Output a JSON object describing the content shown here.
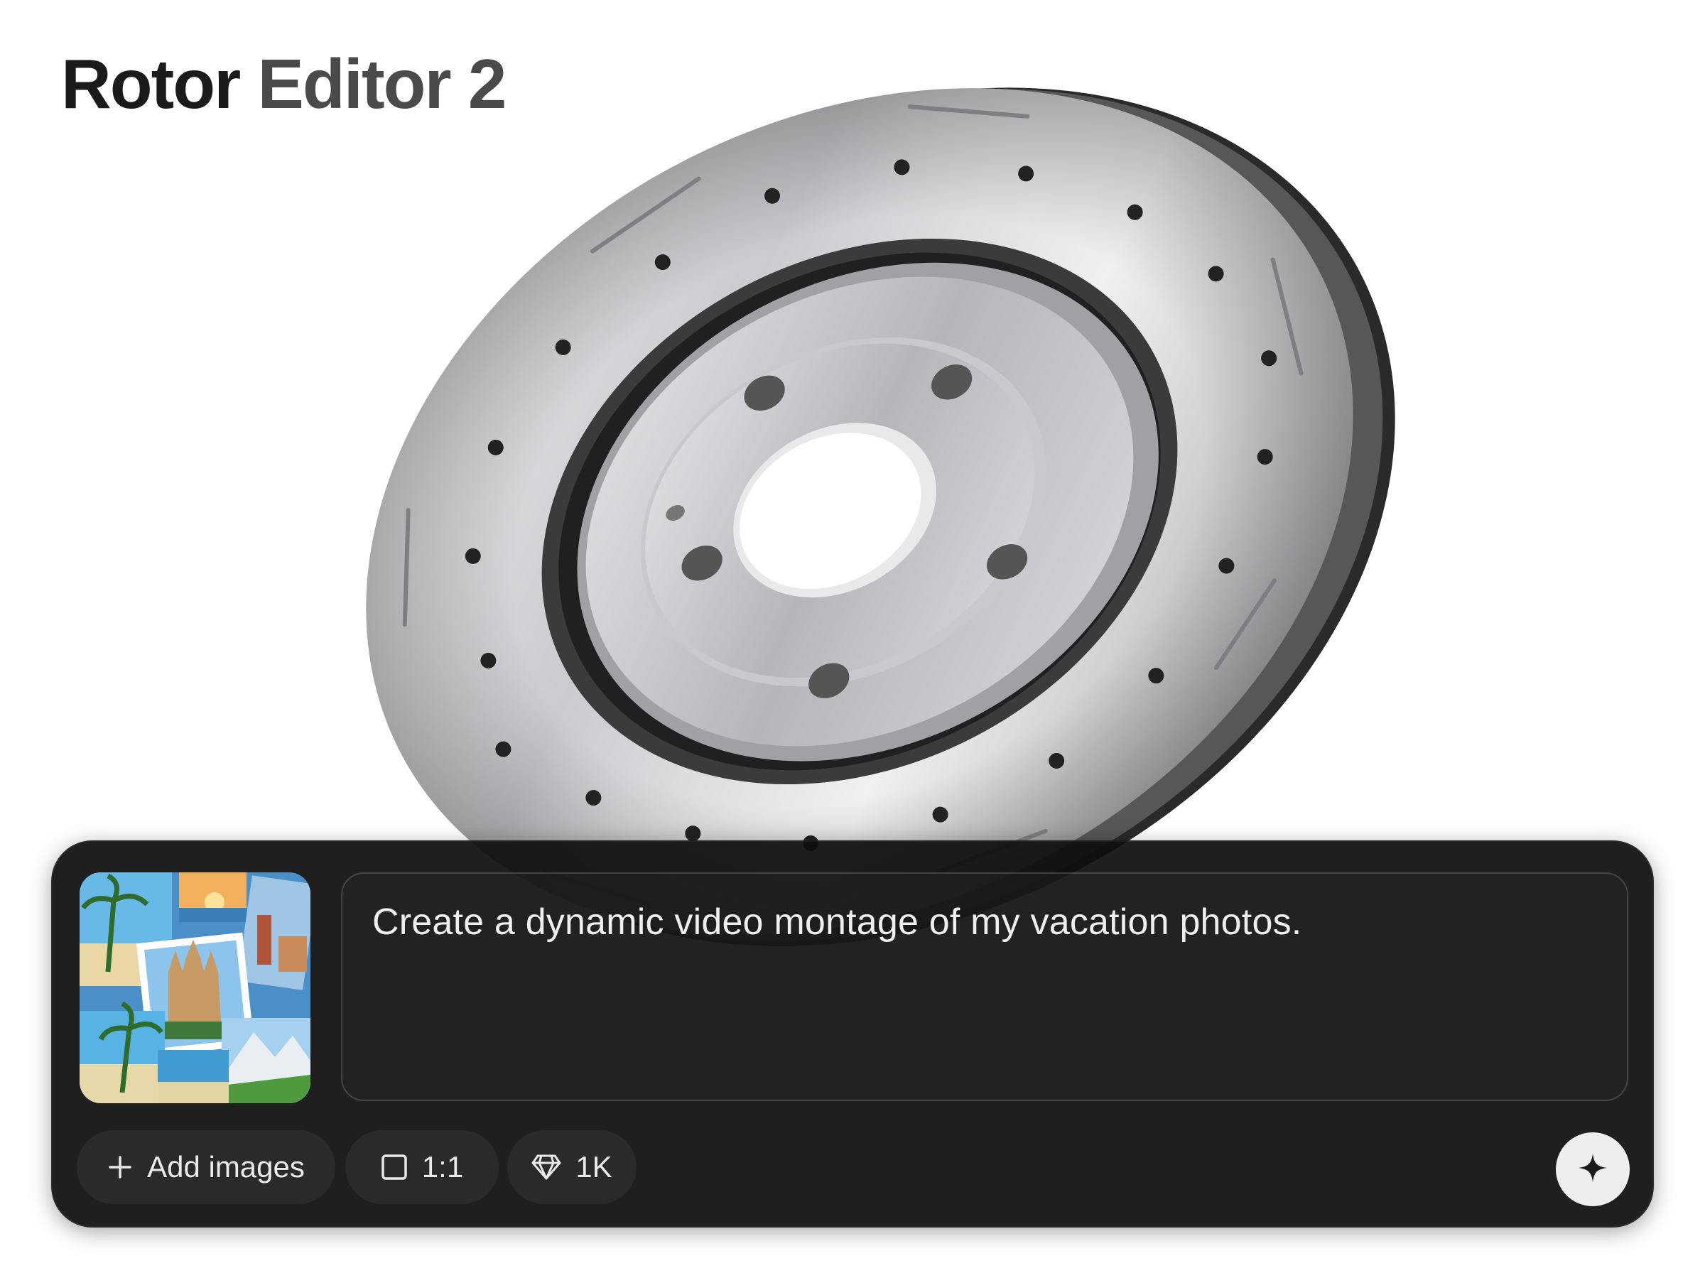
{
  "app": {
    "title_part1": "Rotor",
    "title_part2": "Editor 2"
  },
  "hero_image": {
    "icon": "brake-rotor-image"
  },
  "composer": {
    "thumbnail_icon": "vacation-photos-thumbnail",
    "prompt_value": "Create a dynamic video montage of my vacation photos.",
    "add_images_label": "Add images",
    "aspect_label": "1:1",
    "quality_label": "1K",
    "icons": {
      "add": "plus-icon",
      "aspect": "square-icon",
      "quality": "diamond-icon",
      "send": "sparkle-icon"
    }
  }
}
